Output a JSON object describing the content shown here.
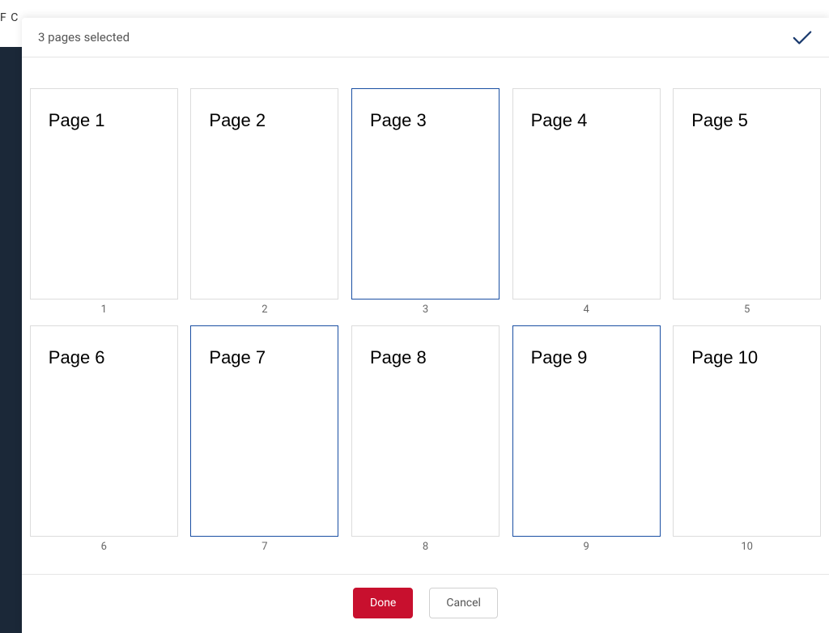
{
  "header": {
    "title": "3 pages selected"
  },
  "pages": [
    {
      "label": "Page 1",
      "number": "1",
      "selected": false
    },
    {
      "label": "Page 2",
      "number": "2",
      "selected": false
    },
    {
      "label": "Page 3",
      "number": "3",
      "selected": true
    },
    {
      "label": "Page 4",
      "number": "4",
      "selected": false
    },
    {
      "label": "Page 5",
      "number": "5",
      "selected": false
    },
    {
      "label": "Page 6",
      "number": "6",
      "selected": false
    },
    {
      "label": "Page 7",
      "number": "7",
      "selected": true
    },
    {
      "label": "Page 8",
      "number": "8",
      "selected": false
    },
    {
      "label": "Page 9",
      "number": "9",
      "selected": true
    },
    {
      "label": "Page 10",
      "number": "10",
      "selected": false
    }
  ],
  "footer": {
    "done_label": "Done",
    "cancel_label": "Cancel"
  },
  "background": {
    "top_text": "F C"
  }
}
